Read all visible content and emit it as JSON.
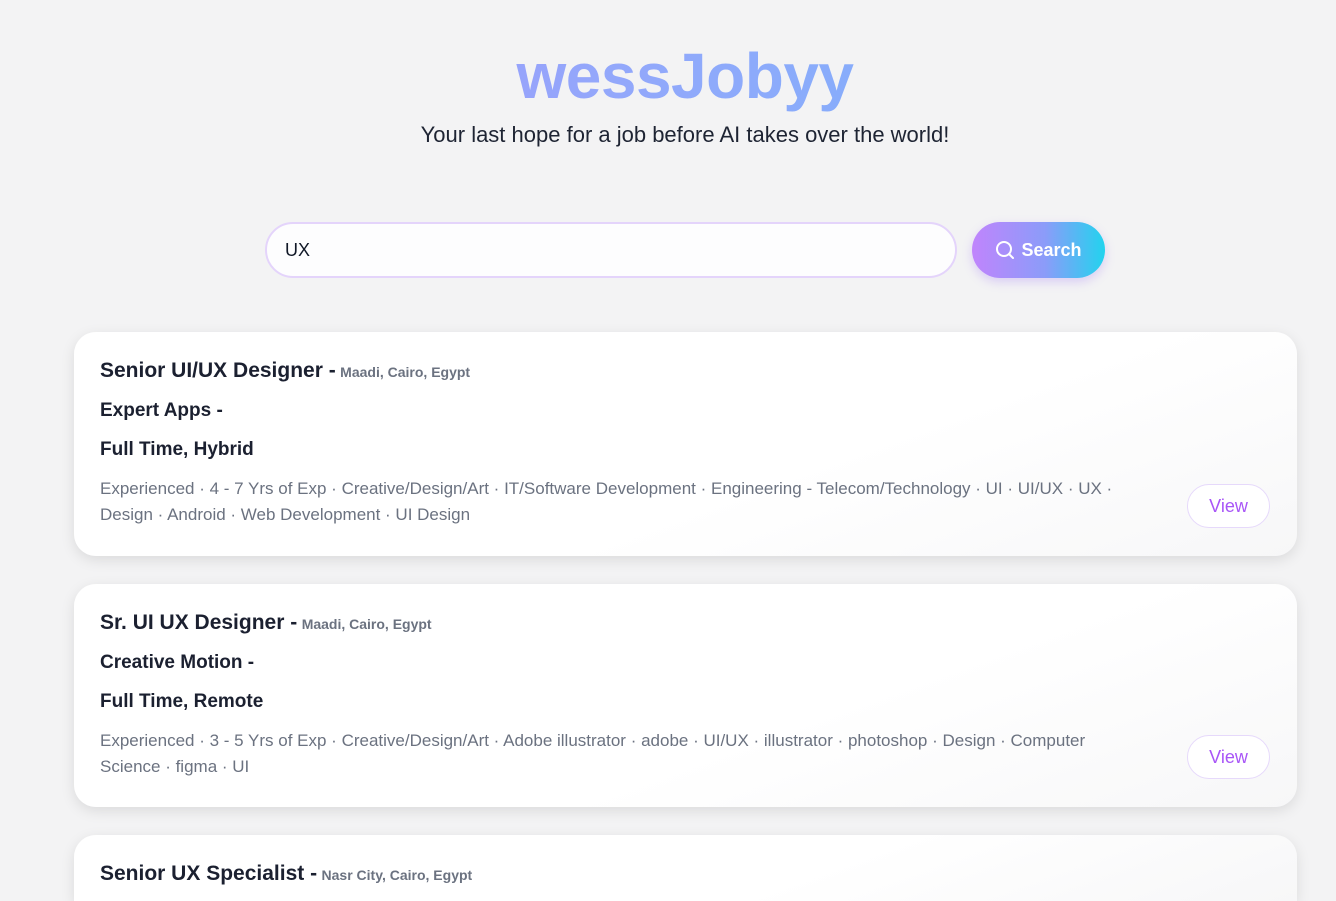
{
  "header": {
    "brand": "wessJobyy",
    "tagline": "Your last hope for a job before AI takes over the world!"
  },
  "search": {
    "value": "UX",
    "button_label": "Search",
    "button_icon": "search-icon"
  },
  "colors": {
    "background": "#f3f3f4",
    "brand_gradient_start": "#a78bfa",
    "brand_gradient_end": "#6fb6fb",
    "accent": "#a855f7",
    "button_gradient_end": "#22d3ee"
  },
  "jobs": [
    {
      "title": "Senior UI/UX Designer -",
      "location": "Maadi, Cairo, Egypt",
      "company": "Expert Apps -",
      "type": "Full Time, Hybrid",
      "tags": "Experienced · 4 - 7 Yrs of Exp · Creative/Design/Art · IT/Software Development · Engineering - Telecom/Technology · UI · UI/UX · UX · Design · Android · Web Development · UI Design",
      "view_label": "View"
    },
    {
      "title": "Sr. UI UX Designer -",
      "location": "Maadi, Cairo, Egypt",
      "company": "Creative Motion -",
      "type": "Full Time, Remote",
      "tags": "Experienced · 3 - 5 Yrs of Exp · Creative/Design/Art · Adobe illustrator · adobe · UI/UX · illustrator · photoshop · Design · Computer Science · figma · UI",
      "view_label": "View"
    },
    {
      "title": "Senior UX Specialist -",
      "location": "Nasr City, Cairo, Egypt"
    }
  ]
}
